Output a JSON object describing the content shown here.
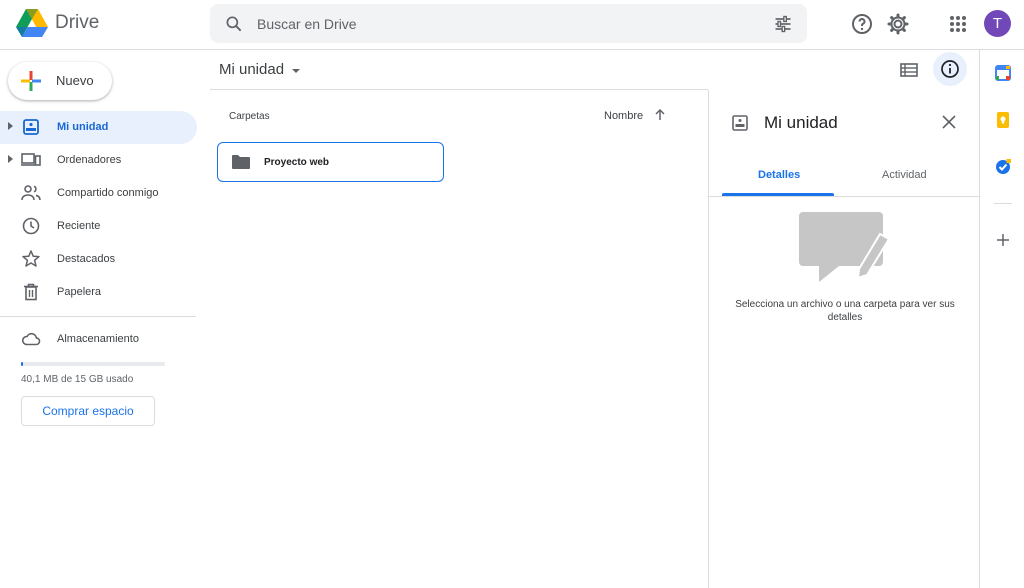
{
  "app": {
    "brand": "Drive"
  },
  "search": {
    "placeholder": "Buscar en Drive"
  },
  "user": {
    "avatar_letter": "T"
  },
  "sidebar": {
    "new_label": "Nuevo",
    "items": [
      {
        "label": "Mi unidad",
        "icon": "my-drive-icon",
        "active": true
      },
      {
        "label": "Ordenadores",
        "icon": "computers-icon"
      },
      {
        "label": "Compartido conmigo",
        "icon": "shared-icon"
      },
      {
        "label": "Reciente",
        "icon": "clock-icon"
      },
      {
        "label": "Destacados",
        "icon": "star-icon"
      },
      {
        "label": "Papelera",
        "icon": "trash-icon"
      },
      {
        "label": "Almacenamiento",
        "icon": "cloud-icon"
      }
    ],
    "storage_text": "40,1 MB de 15 GB usado",
    "storage_fraction": 0.003,
    "buy_label": "Comprar espacio"
  },
  "main": {
    "title": "Mi unidad",
    "section_label": "Carpetas",
    "sort_label": "Nombre",
    "folders": [
      {
        "name": "Proyecto web"
      }
    ]
  },
  "details": {
    "title": "Mi unidad",
    "tabs": [
      {
        "label": "Detalles",
        "active": true
      },
      {
        "label": "Actividad"
      }
    ],
    "empty_text": "Selecciona un archivo o una carpeta para ver sus detalles"
  },
  "colors": {
    "accent": "#1a73e8",
    "active_bg": "#e8f0fe",
    "avatar": "#7248b9"
  }
}
